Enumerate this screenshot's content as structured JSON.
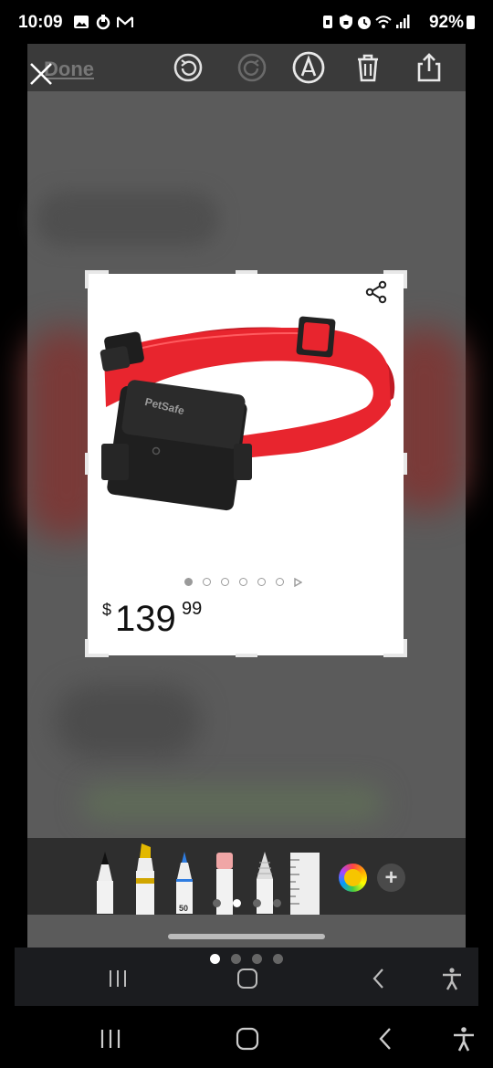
{
  "status_bar": {
    "time": "10:09",
    "battery_percent": "92%",
    "left_icons": [
      "gallery-icon",
      "link-icon",
      "gmail-icon"
    ],
    "right_icons": [
      "sim-icon",
      "vpn-icon",
      "alarm-icon",
      "wifi-icon",
      "signal-icon",
      "battery-icon"
    ]
  },
  "toolbar": {
    "close_icon": "close-icon",
    "done_label": "Done",
    "tools": [
      "undo-icon",
      "redo-icon",
      "pen-mode-icon",
      "delete-icon",
      "share-icon"
    ]
  },
  "product": {
    "price_currency": "$",
    "price_whole": "139",
    "price_fraction": "99",
    "brand_on_device": "PetSafe",
    "carousel_total": 6,
    "carousel_active": 0
  },
  "pen_tray": {
    "pens": [
      "pen-icon",
      "highlighter-icon",
      "marker-icon",
      "eraser-icon",
      "pencil-icon",
      "ruler-icon"
    ],
    "marker_size_label": "50",
    "selected_color": "#f7c500",
    "add_label": "+"
  },
  "navigation": {
    "inner": [
      "recent-apps-icon",
      "home-icon",
      "back-icon",
      "accessibility-icon"
    ],
    "system": [
      "recent-apps-icon",
      "home-icon",
      "back-icon",
      "accessibility-icon"
    ]
  },
  "colors": {
    "collar_red": "#e8252e",
    "device_black": "#1f1f1f",
    "selected_pen_color": "#f7c500"
  }
}
